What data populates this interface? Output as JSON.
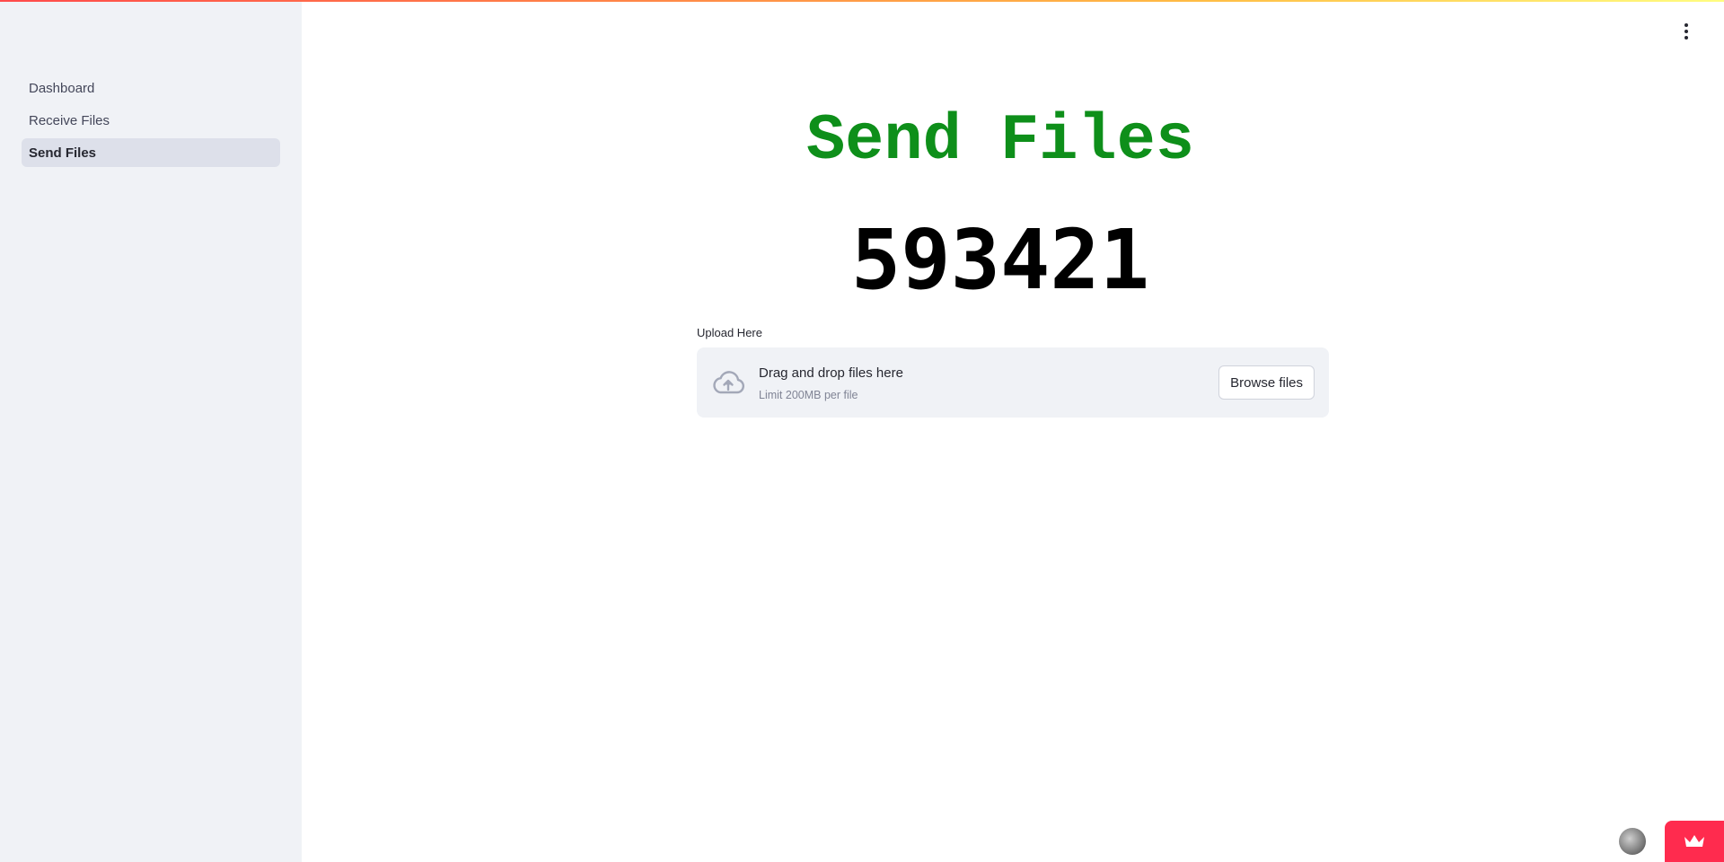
{
  "sidebar": {
    "items": [
      {
        "label": "Dashboard",
        "active": false
      },
      {
        "label": "Receive Files",
        "active": false
      },
      {
        "label": "Send Files",
        "active": true
      }
    ]
  },
  "main": {
    "title": "Send Files",
    "code": "593421",
    "uploader": {
      "label": "Upload Here",
      "drop_text": "Drag and drop files here",
      "limit_text": "Limit 200MB per file",
      "browse_label": "Browse files"
    }
  },
  "colors": {
    "title": "#0e8f1a",
    "accent": "#ff4b4b",
    "sidebar_bg": "#f0f2f6",
    "badge": "#ff2b4e"
  },
  "icons": {
    "menu": "vertical-dots-icon",
    "upload": "cloud-upload-icon",
    "badge": "crown-icon"
  }
}
